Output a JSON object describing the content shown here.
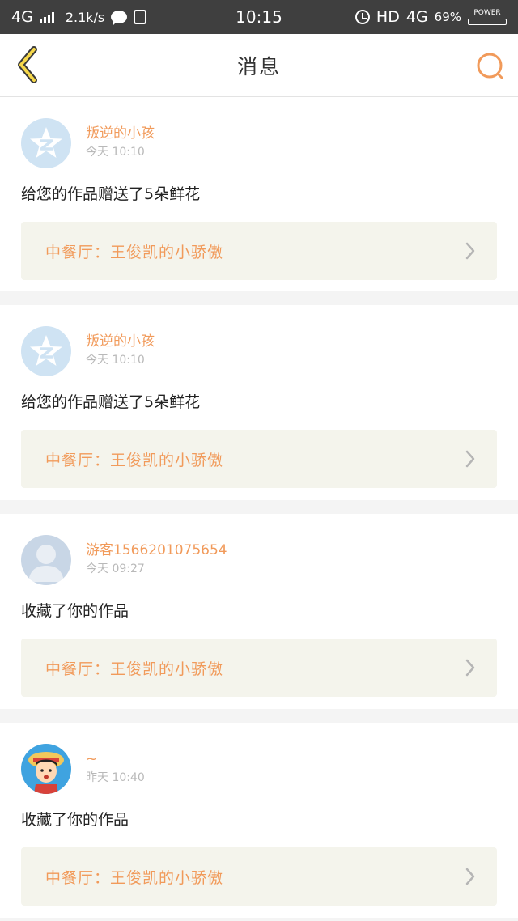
{
  "status_bar": {
    "network": "4G",
    "speed": "2.1k/s",
    "time": "10:15",
    "hd": "HD",
    "network2": "4G",
    "battery": "69%",
    "battery_label": "POWER",
    "battery_level": 0.69
  },
  "header": {
    "title": "消息",
    "back_icon": "chevron-left-icon",
    "search_icon": "search-icon",
    "accent_color": "#f19a5a"
  },
  "messages": [
    {
      "avatar": "qzone-avatar",
      "username": "叛逆的小孩",
      "time": "今天 10:10",
      "text": "给您的作品赠送了5朵鲜花",
      "work": "中餐厅：王俊凯的小骄傲"
    },
    {
      "avatar": "qzone-avatar",
      "username": "叛逆的小孩",
      "time": "今天 10:10",
      "text": "给您的作品赠送了5朵鲜花",
      "work": "中餐厅：王俊凯的小骄傲"
    },
    {
      "avatar": "default-avatar",
      "username": "游客1566201075654",
      "time": "今天 09:27",
      "text": "收藏了你的作品",
      "work": "中餐厅：王俊凯的小骄傲"
    },
    {
      "avatar": "cartoon-avatar",
      "username": "~",
      "time": "昨天 10:40",
      "text": "收藏了你的作品",
      "work": "中餐厅：王俊凯的小骄傲"
    }
  ]
}
